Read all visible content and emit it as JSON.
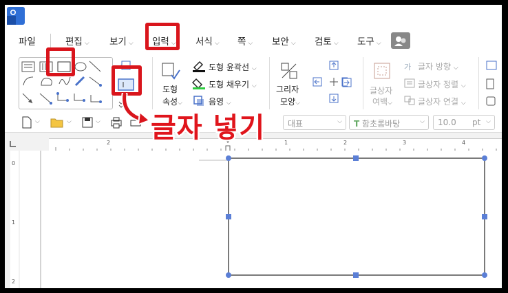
{
  "menu": {
    "items": [
      {
        "label": "파일",
        "chevron": false
      },
      {
        "label": "편집",
        "chevron": true
      },
      {
        "label": "보기",
        "chevron": true
      },
      {
        "label": "입력",
        "chevron": true
      },
      {
        "label": "서식",
        "chevron": true
      },
      {
        "label": "쪽",
        "chevron": true
      },
      {
        "label": "보안",
        "chevron": true
      },
      {
        "label": "검토",
        "chevron": true
      },
      {
        "label": "도구",
        "chevron": true
      }
    ]
  },
  "ribbon": {
    "shape_props_line1": "도형",
    "shape_props_line2": "속성",
    "shape_outline": "도형 윤곽선",
    "shape_fill": "도형 채우기",
    "shadow": "음영",
    "picture_shape_line1": "그리자",
    "picture_shape_line2": "모양",
    "text_margin_line1": "글상자",
    "text_margin_line2": "여백",
    "text_direction": "글자 방향",
    "text_align": "글상자 정렬",
    "text_link": "글상자 연결",
    "colors": {
      "outline_swatch": "#111111",
      "fill_swatch": "#2ecc40",
      "accent": "#4a72c9"
    }
  },
  "toolbar": {
    "style_combo": "대표",
    "font_combo": "함초롬바탕",
    "size_combo": "10.0",
    "size_unit": "pt"
  },
  "ruler": {
    "h_labels": [
      "2",
      "1",
      "2",
      "3",
      "4"
    ],
    "v_labels": [
      "0",
      "1",
      "2"
    ]
  },
  "annotation": {
    "text": "글자 넣기",
    "color": "#e0151c"
  }
}
